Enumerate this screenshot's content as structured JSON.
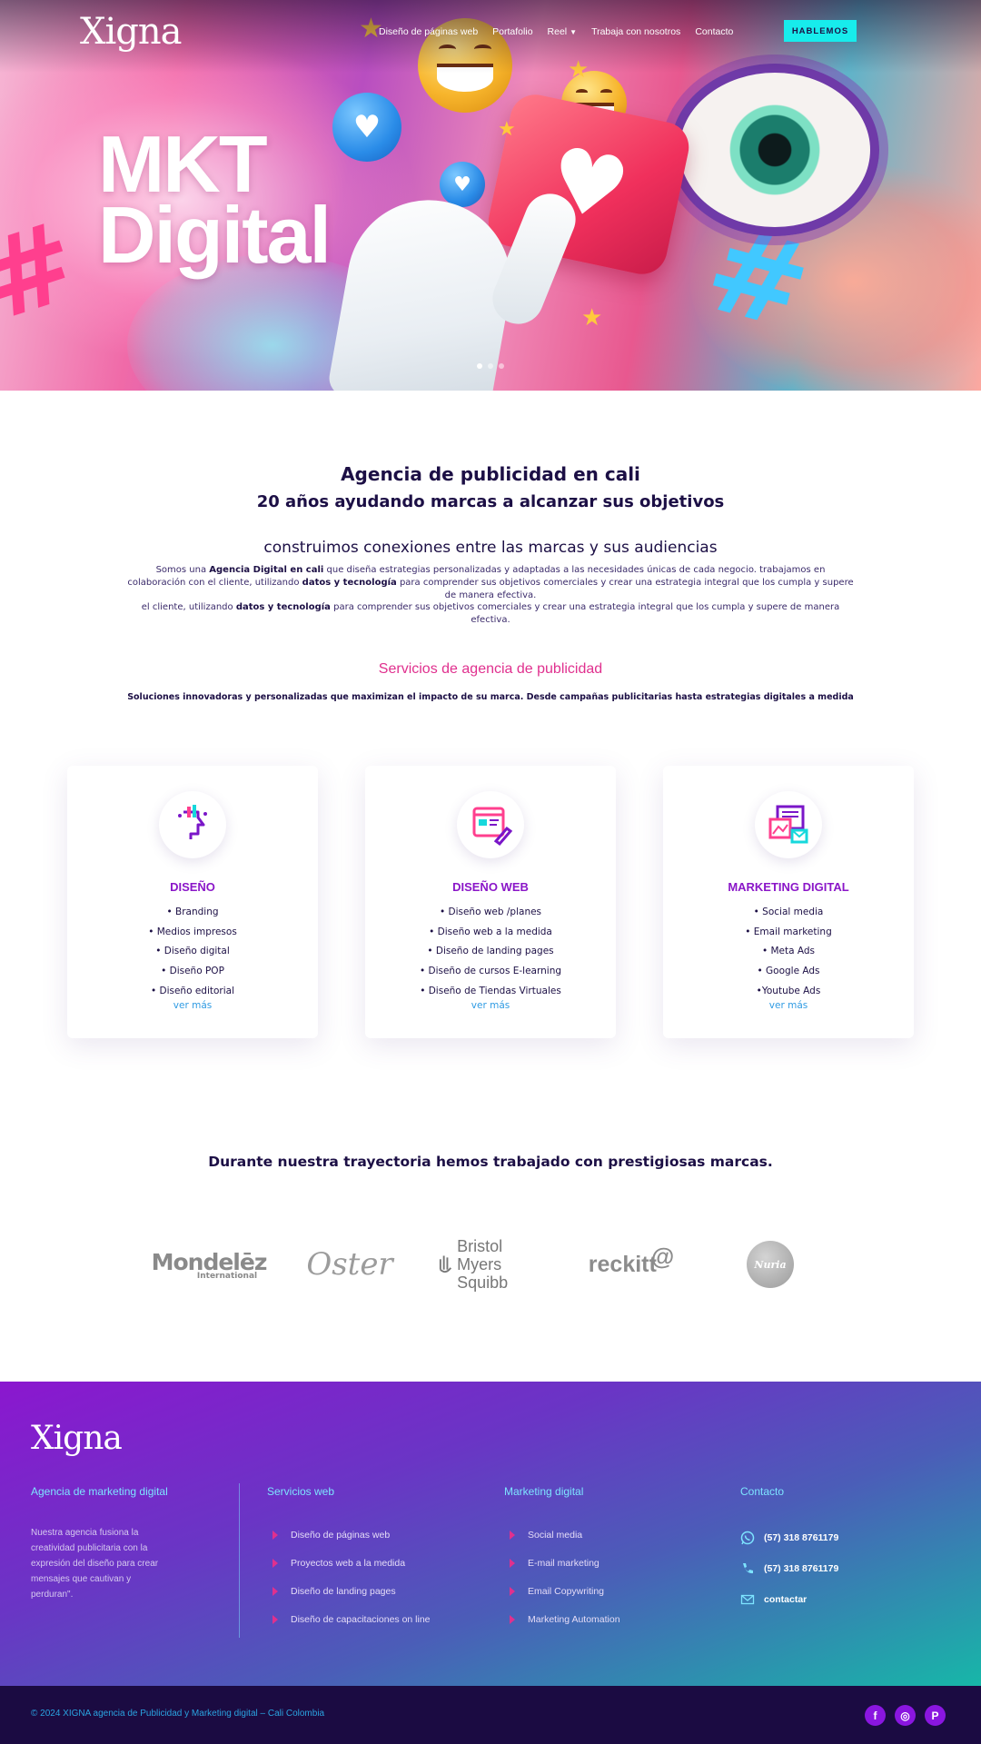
{
  "brand": {
    "logo": "Xigna",
    "colors": {
      "primary": "#8a16c8",
      "accent": "#17ecec",
      "pink": "#e0308e",
      "navy": "#1c0f45"
    }
  },
  "nav": {
    "items": [
      "Diseño de páginas web",
      "Portafolio",
      "Reel",
      "Trabaja con nosotros",
      "Contacto"
    ],
    "cta": "HABLEMOS"
  },
  "hero": {
    "title_line1": "MKT",
    "title_line2": "Digital",
    "slides": 3,
    "active_slide": 1
  },
  "intro": {
    "heading": "Agencia de publicidad en cali",
    "subheading": "20 años ayudando marcas a alcanzar sus objetivos",
    "tagline": "construimos conexiones entre las marcas y sus audiencias",
    "p_part1": "Somos una ",
    "p_bold1": "Agencia Digital en cali",
    "p_part2": " que diseña estrategias personalizadas y adaptadas a las necesidades únicas de cada negocio. trabajamos en colaboración con el cliente, utilizando ",
    "p_bold2": "datos y tecnología",
    "p_part3": " para comprender sus objetivos comerciales y crear una estrategia integral que los cumpla y supere de manera efectiva.",
    "p2_part1": "el cliente, utilizando ",
    "p2_bold": "datos y tecnología",
    "p2_part2": " para comprender sus objetivos comerciales y crear una estrategia integral que los cumpla y supere de manera efectiva."
  },
  "services": {
    "title": "Servicios de agencia de publicidad",
    "subtitle": "Soluciones innovadoras y personalizadas que maximizan el impacto de su marca. Desde campañas publicitarias hasta estrategias digitales a medida",
    "cards": [
      {
        "icon": "design-head-icon",
        "title": "DISEÑO",
        "items": [
          "• Branding",
          "• Medios impresos",
          "• Diseño digital",
          "• Diseño POP",
          "• Diseño editorial"
        ],
        "more": "ver más"
      },
      {
        "icon": "web-design-icon",
        "title": "DISEÑO WEB",
        "items": [
          "• Diseño web /planes",
          "• Diseño web a la medida",
          "• Diseño de landing pages",
          "• Diseño de cursos E-learning",
          "• Diseño de Tiendas Virtuales"
        ],
        "more": "ver más"
      },
      {
        "icon": "marketing-icon",
        "title": "MARKETING DIGITAL",
        "items": [
          "• Social media",
          "• Email marketing",
          "• Meta Ads",
          "• Google Ads",
          "•Youtube Ads"
        ],
        "more": "ver más"
      }
    ]
  },
  "brands": {
    "title": "Durante nuestra trayectoria hemos trabajado con prestigiosas marcas.",
    "logos": [
      "Mondelēz",
      "International",
      "Oster",
      "Bristol Myers",
      "Squibb",
      "reckitt",
      "Nuria"
    ]
  },
  "footer": {
    "logo": "Xigna",
    "col1_title": "Agencia de marketing digital",
    "about": "Nuestra agencia fusiona la creatividad publicitaria con la expresión del diseño para crear mensajes que cautivan y perduran\".",
    "col2_title": "Servicios web",
    "col2_items": [
      "Diseño de páginas web",
      "Proyectos web a la medida",
      "Diseño de landing pages",
      "Diseño de capacitaciones on line"
    ],
    "col3_title": "Marketing digital",
    "col3_items": [
      "Social media",
      "E-mail marketing",
      "Email Copywriting",
      "Marketing Automation"
    ],
    "col4_title": "Contacto",
    "contacts": [
      {
        "icon": "whatsapp-icon",
        "text": "(57) 318 8761179"
      },
      {
        "icon": "phone-icon",
        "text": "(57) 318 8761179"
      },
      {
        "icon": "mail-icon",
        "text": "contactar"
      }
    ],
    "copyright": "© 2024 XIGNA agencia de Publicidad y Marketing digital – Cali Colombia",
    "social": [
      {
        "icon": "facebook-icon",
        "glyph": "f"
      },
      {
        "icon": "instagram-icon",
        "glyph": "◎"
      },
      {
        "icon": "pinterest-icon",
        "glyph": "P"
      }
    ]
  }
}
